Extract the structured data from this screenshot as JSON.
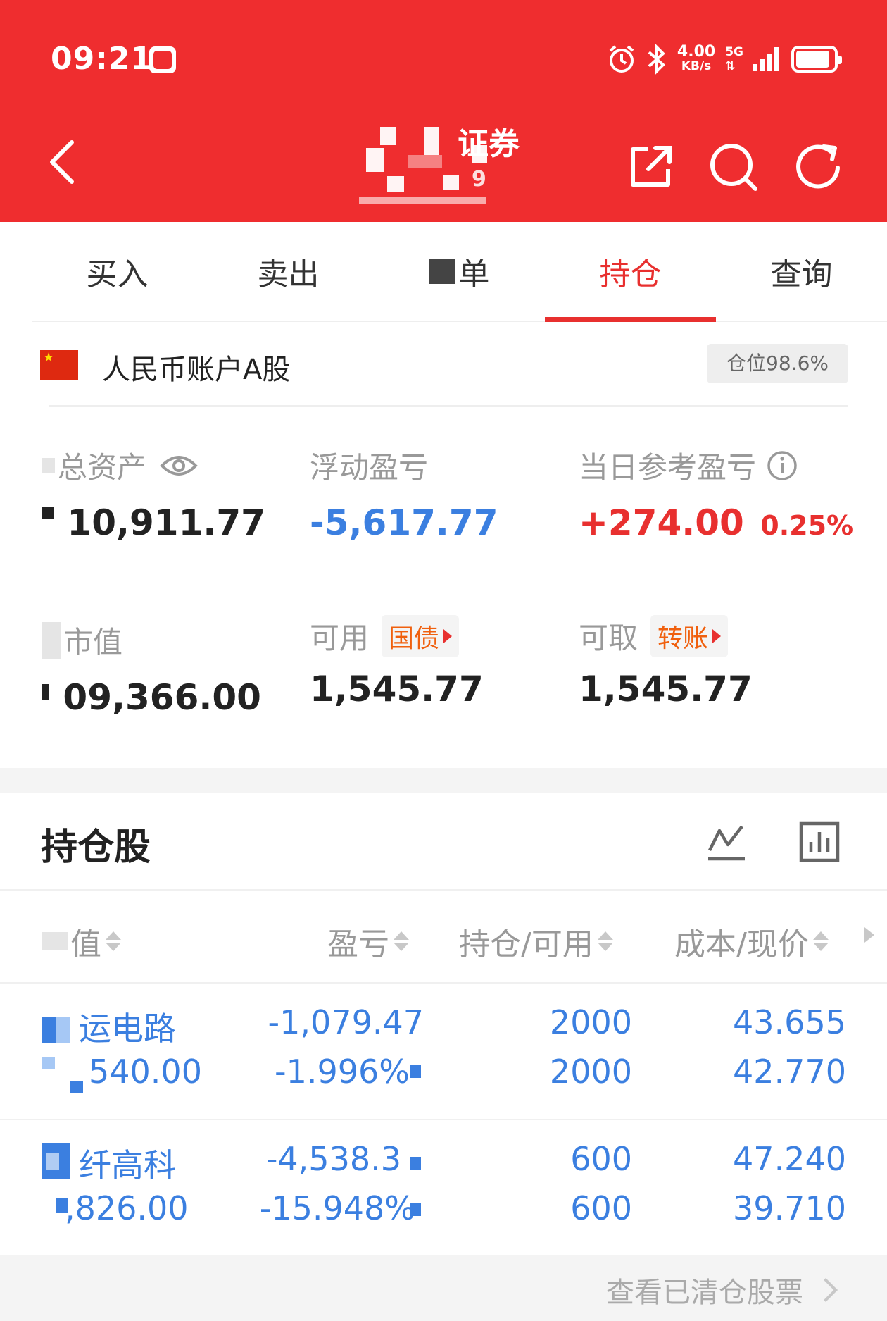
{
  "status_bar": {
    "time": "09:21",
    "net_speed": "4.00",
    "net_speed_unit": "KB/s",
    "network": "5G",
    "icons": [
      "alarm-icon",
      "bluetooth-icon",
      "signal-icon",
      "battery-icon"
    ]
  },
  "nav": {
    "title": "证券",
    "title_suffix": "9",
    "icons": [
      "back-icon",
      "share-icon",
      "search-icon",
      "refresh-icon"
    ]
  },
  "tabs": [
    {
      "label": "买入",
      "active": false
    },
    {
      "label": "卖出",
      "active": false
    },
    {
      "label": "单",
      "active": false
    },
    {
      "label": "持仓",
      "active": true
    },
    {
      "label": "查询",
      "active": false
    }
  ],
  "account": {
    "name": "人民币账户A股",
    "position": "仓位98.6%"
  },
  "assets": {
    "total_label": "总资产",
    "total_value": "10,911.77",
    "float_pl_label": "浮动盈亏",
    "float_pl_value": "-5,617.77",
    "daily_pl_label": "当日参考盈亏",
    "daily_pl_value": "+274.00",
    "daily_pl_pct": "0.25%",
    "market_value_label": "市值",
    "market_value": "09,366.00",
    "available_label": "可用",
    "available_tag": "国债",
    "available_value": "1,545.77",
    "withdrawable_label": "可取",
    "withdrawable_tag": "转账",
    "withdrawable_value": "1,545.77"
  },
  "holdings": {
    "title": "持仓股",
    "columns": [
      "值",
      "盈亏",
      "持仓/可用",
      "成本/现价"
    ],
    "rows": [
      {
        "name": "运电路",
        "value": "540.00",
        "pl": "-1,079.47",
        "pl_pct": "-1.996%",
        "hold": "2000",
        "avail": "2000",
        "cost": "43.655",
        "price": "42.770"
      },
      {
        "name": "纤高科",
        "value": ",826.00",
        "pl": "-4,538.3",
        "pl_pct": "-15.948%",
        "hold": "600",
        "avail": "600",
        "cost": "47.240",
        "price": "39.710"
      }
    ],
    "footer_link": "查看已清仓股票"
  },
  "colors": {
    "brand_red": "#ef2d2f",
    "negative_blue": "#3b7fe0",
    "positive_red": "#e8302f",
    "tag_orange": "#f0600e"
  }
}
